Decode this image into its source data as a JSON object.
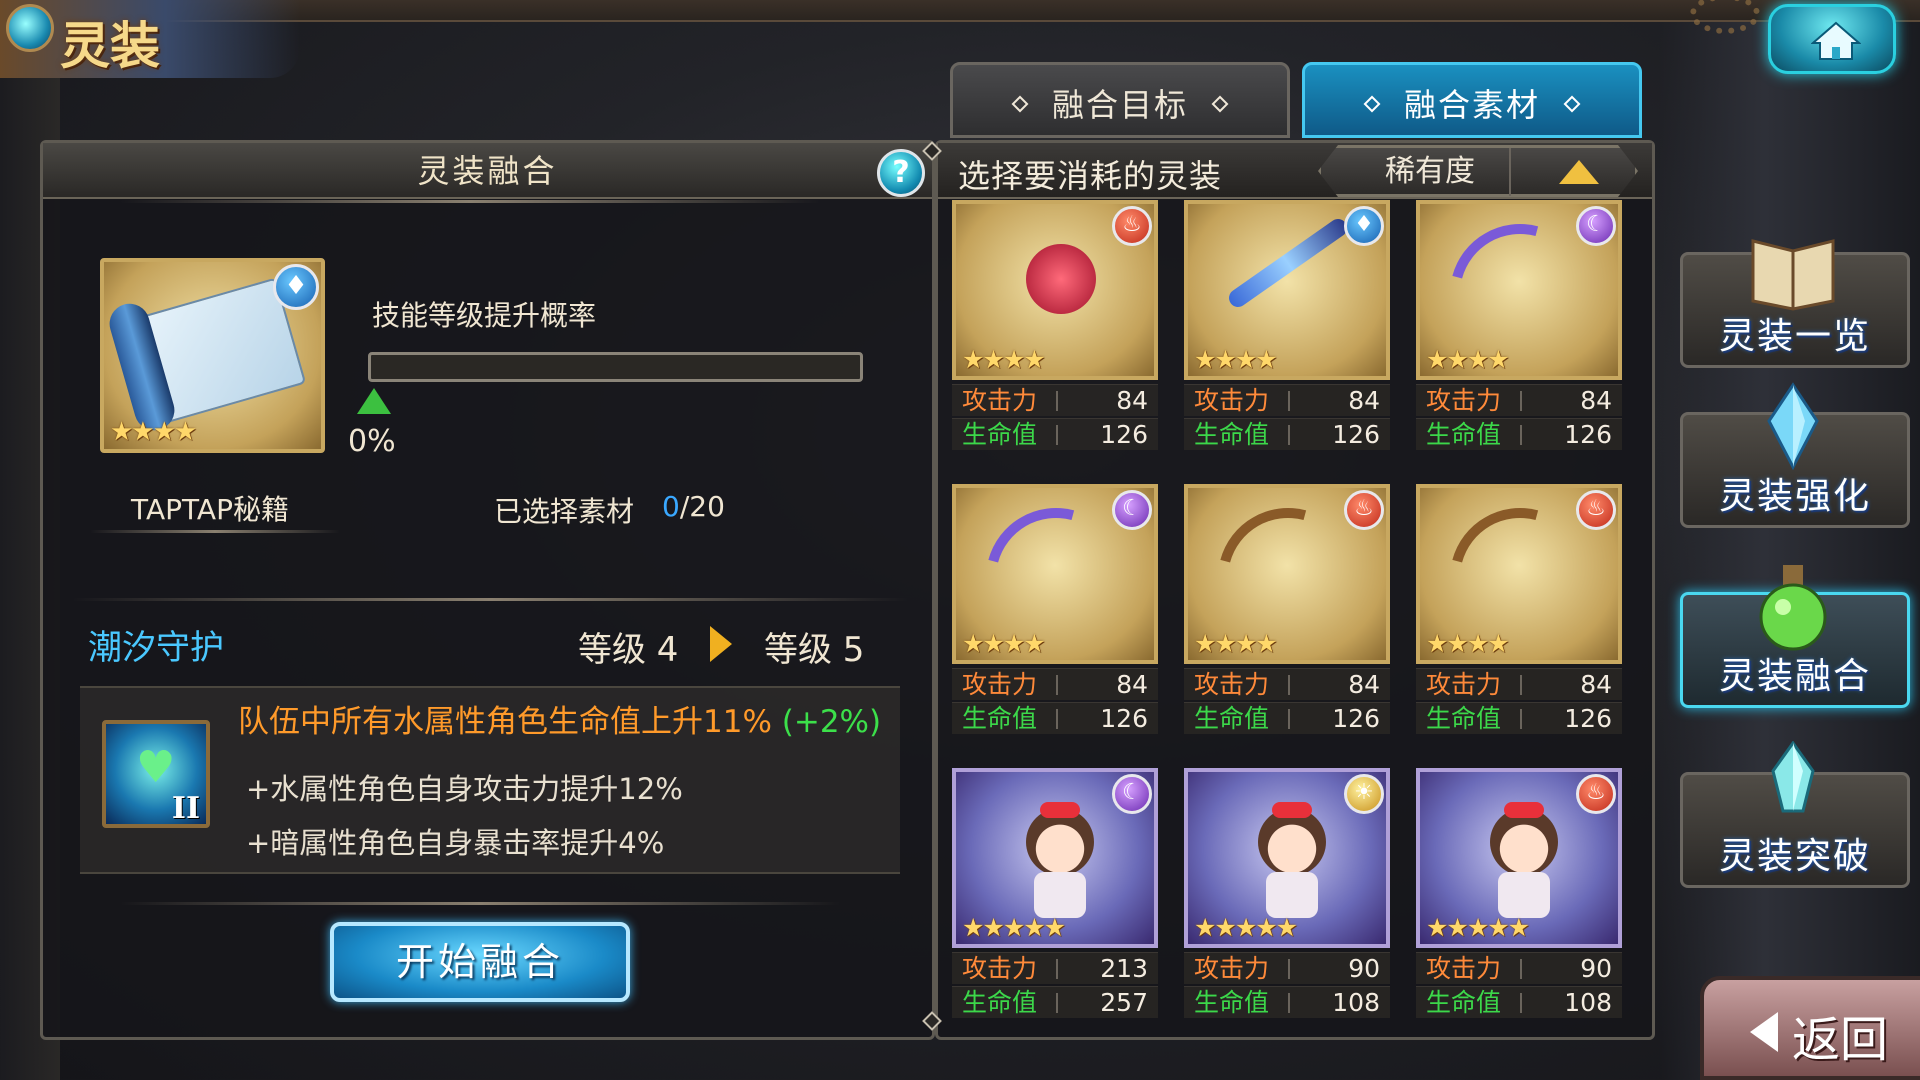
{
  "header": {
    "title": "灵装"
  },
  "tabs": [
    {
      "label": "融合目标",
      "active": false
    },
    {
      "label": "融合素材",
      "active": true
    }
  ],
  "left_panel": {
    "title": "灵装融合",
    "help_label": "?",
    "target": {
      "name": "TAPTAP秘籍",
      "element": "water",
      "stars": "★★★★"
    },
    "skill_up_label": "技能等级提升概率",
    "skill_up_percent": "0%",
    "skill_up_progress": 0,
    "selected_label": "已选择素材",
    "selected_count": "0",
    "selected_max": "/20",
    "skill": {
      "name": "潮汐守护",
      "level_from": "等级 4",
      "level_to": "等级 5",
      "icon_rank": "II",
      "main_effect": "队伍中所有水属性角色生命值上升11%",
      "main_bonus": "(+2%)",
      "sub_effects": [
        "+水属性角色自身攻击力提升12%",
        "+暗属性角色自身暴击率提升4%"
      ]
    },
    "fuse_button": "开始融合"
  },
  "right_panel": {
    "title": "选择要消耗的灵装",
    "sort_label": "稀有度",
    "atk_label": "攻击力",
    "hp_label": "生命值",
    "materials": [
      {
        "element": "fire",
        "element_glyph": "♨",
        "art": "rose",
        "stars": "★★★★",
        "atk": "84",
        "hp": "126"
      },
      {
        "element": "water",
        "element_glyph": "♦",
        "art": "spear",
        "stars": "★★★★",
        "atk": "84",
        "hp": "126"
      },
      {
        "element": "dark",
        "element_glyph": "☾",
        "art": "bow",
        "stars": "★★★★",
        "atk": "84",
        "hp": "126"
      },
      {
        "element": "dark",
        "element_glyph": "☾",
        "art": "bow",
        "stars": "★★★★",
        "atk": "84",
        "hp": "126"
      },
      {
        "element": "fire",
        "element_glyph": "♨",
        "art": "bowgold",
        "stars": "★★★★",
        "atk": "84",
        "hp": "126"
      },
      {
        "element": "fire",
        "element_glyph": "♨",
        "art": "bowgold",
        "stars": "★★★★",
        "atk": "84",
        "hp": "126"
      },
      {
        "element": "dark",
        "element_glyph": "☾",
        "art": "doll",
        "stars": "★★★★★",
        "atk": "213",
        "hp": "257"
      },
      {
        "element": "light",
        "element_glyph": "☀",
        "art": "doll",
        "stars": "★★★★★",
        "atk": "90",
        "hp": "108"
      },
      {
        "element": "fire",
        "element_glyph": "♨",
        "art": "doll",
        "stars": "★★★★★",
        "atk": "90",
        "hp": "108"
      }
    ]
  },
  "side_menu": [
    {
      "label": "灵装一览",
      "icon": "book-icon",
      "active": false
    },
    {
      "label": "灵装强化",
      "icon": "crystal-icon",
      "active": false
    },
    {
      "label": "灵装融合",
      "icon": "potion-icon",
      "active": true
    },
    {
      "label": "灵装突破",
      "icon": "gem-icon",
      "active": false
    }
  ],
  "back_button": "返回",
  "colors": {
    "accent": "#2ad0e0",
    "attack": "#ff8a3a",
    "hp": "#3cd84a",
    "skill_name": "#4ac8ff",
    "effect": "#ff9a2a"
  }
}
